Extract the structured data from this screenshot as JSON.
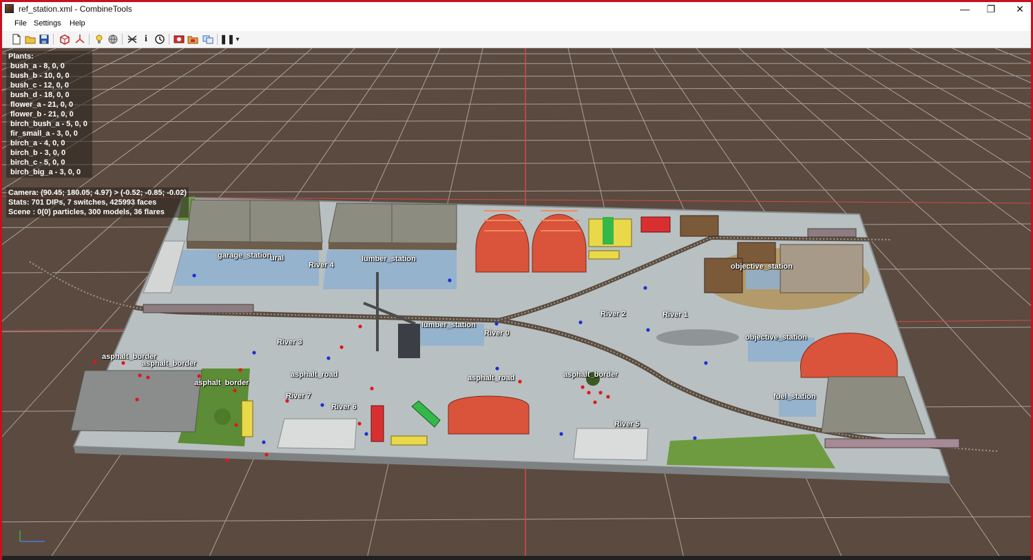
{
  "window": {
    "title": "ref_station.xml - CombineTools",
    "controls": {
      "minimize": "—",
      "restore": "❐",
      "close": "✕"
    }
  },
  "menu": {
    "items": [
      "File",
      "Settings",
      "Help"
    ]
  },
  "toolbar": {
    "buttons": [
      "new-icon",
      "open-icon",
      "save-icon",
      "box-icon",
      "axis-icon",
      "light-icon",
      "sphere-icon",
      "grid-icon",
      "info-icon",
      "clock-icon",
      "record-icon",
      "folder-icon",
      "copy-icon",
      "pause-icon",
      "dropdown-arrow-icon"
    ],
    "info_glyph": "i",
    "pause_glyph": "❚❚",
    "dropdown_glyph": "▾"
  },
  "plants": {
    "header": "Plants:",
    "items": [
      "bush_a - 8, 0, 0",
      "bush_b - 10, 0, 0",
      "bush_c - 12, 0, 0",
      "bush_d - 18, 0, 0",
      "flower_a - 21, 0, 0",
      "flower_b - 21, 0, 0",
      "birch_bush_a - 5, 0, 0",
      "fir_small_a - 3, 0, 0",
      "birch_a - 4, 0, 0",
      "birch_b - 3, 0, 0",
      "birch_c - 5, 0, 0",
      "birch_big_a - 3, 0, 0"
    ]
  },
  "stats": {
    "camera": "Camera: (90.45; 180.05; 4.97) > (-0.52; -0.85; -0.02)",
    "stats": "Stats: 701 DIPs, 7 switches, 425993 faces",
    "scene": "Scene : 0(0) particles, 300 models, 36 flares"
  },
  "scene_labels": [
    "garage_station",
    "ural",
    "River 4",
    "lumber_station",
    "objective_station",
    "lumber_station",
    "River 0",
    "River 2",
    "River 1",
    "objective_station",
    "River 3",
    "asphalt_border",
    "asphalt_border",
    "asphalt_border",
    "asphalt_road",
    "asphalt_road",
    "asphalt_border",
    "River 7",
    "River 6",
    "fuel_station",
    "River 5"
  ],
  "colors": {
    "window_border": "#c8101e",
    "viewport_bg": "#5b4a3f",
    "grid_line": "#a7a4a2",
    "grid_axis": "#d24b4b"
  }
}
